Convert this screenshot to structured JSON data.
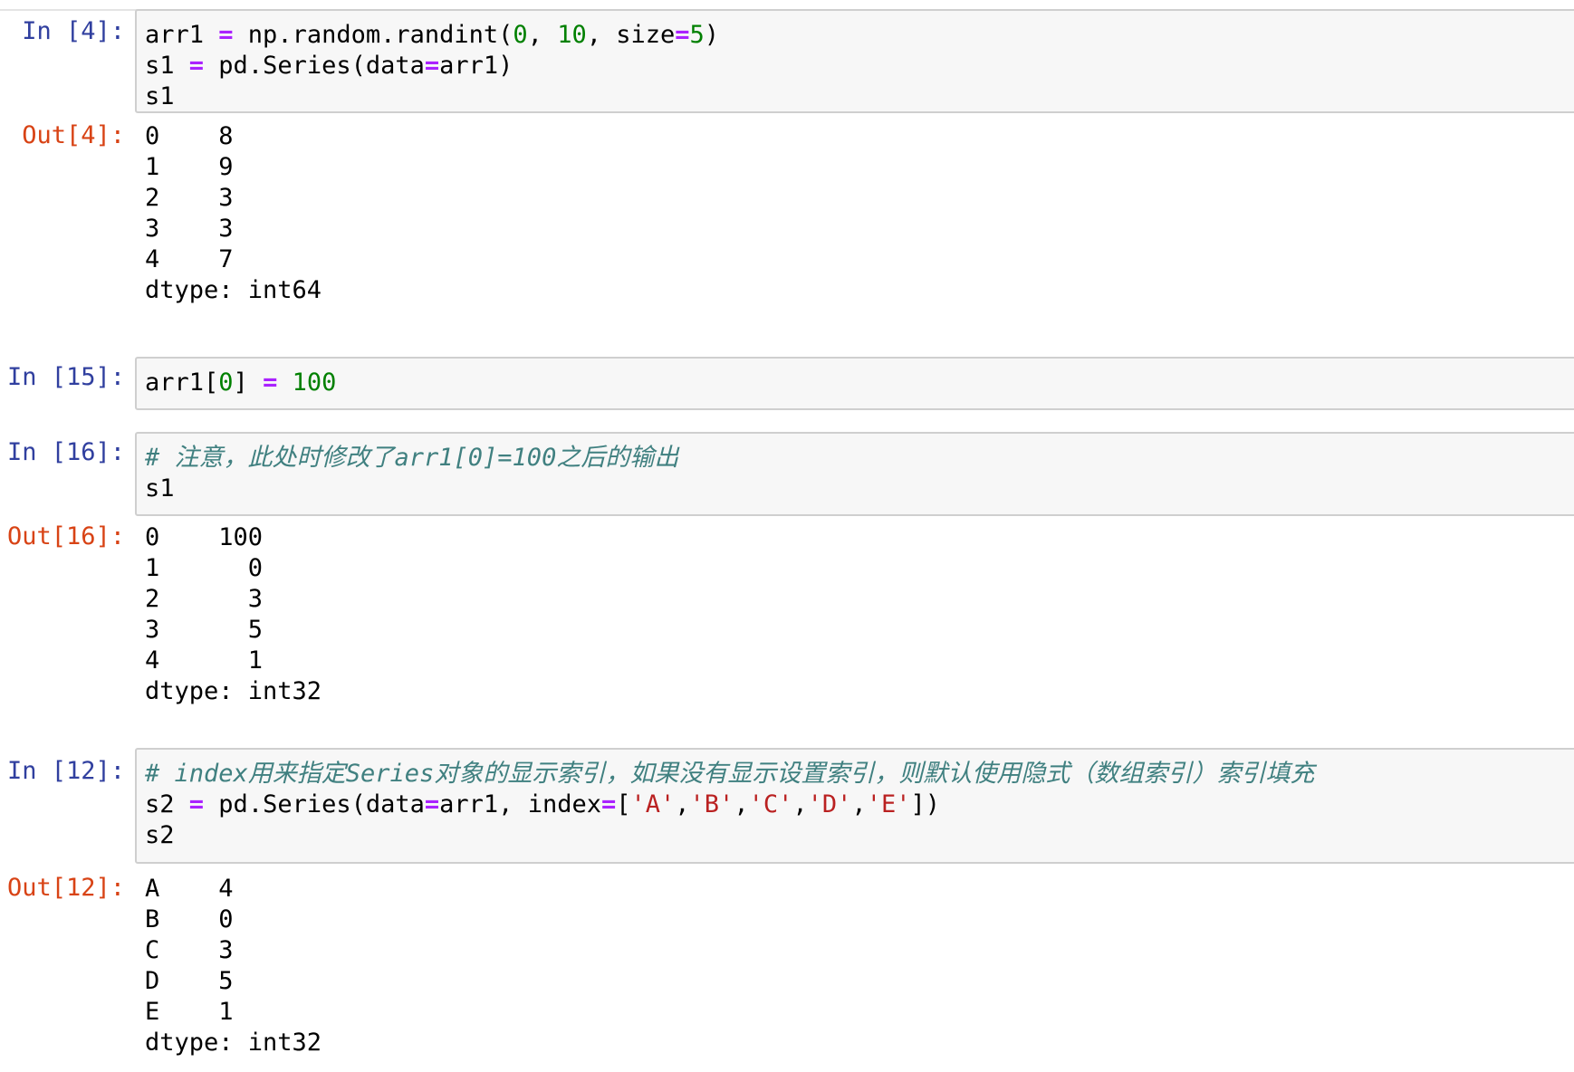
{
  "cells": [
    {
      "in_prompt": "In [4]:",
      "code": [
        [
          [
            "arr1 ",
            ""
          ],
          [
            "=",
            "op"
          ],
          [
            " np.random.randint(",
            ""
          ],
          [
            "0",
            "num"
          ],
          [
            ", ",
            ""
          ],
          [
            "10",
            "num"
          ],
          [
            ", size",
            ""
          ],
          [
            "=",
            "op"
          ],
          [
            "5",
            "num"
          ],
          [
            ")",
            ""
          ]
        ],
        [
          [
            "s1 ",
            ""
          ],
          [
            "=",
            "op"
          ],
          [
            " pd.Series(data",
            ""
          ],
          [
            "=",
            "op"
          ],
          [
            "arr1)",
            ""
          ]
        ],
        [
          [
            "s1",
            ""
          ]
        ]
      ],
      "out_prompt": "Out[4]:",
      "output": [
        "0    8",
        "1    9",
        "2    3",
        "3    3",
        "4    7",
        "dtype: int64"
      ]
    },
    {
      "in_prompt": "In [15]:",
      "code": [
        [
          [
            "arr1[",
            ""
          ],
          [
            "0",
            "num"
          ],
          [
            "] ",
            ""
          ],
          [
            "=",
            "op"
          ],
          [
            " ",
            ""
          ],
          [
            "100",
            "num"
          ]
        ]
      ]
    },
    {
      "in_prompt": "In [16]:",
      "code": [
        [
          [
            "# 注意，此处时修改了arr1[0]=100之后的输出",
            "comment"
          ]
        ],
        [
          [
            "s1",
            ""
          ]
        ]
      ],
      "out_prompt": "Out[16]:",
      "output": [
        "0    100",
        "1      0",
        "2      3",
        "3      5",
        "4      1",
        "dtype: int32"
      ]
    },
    {
      "in_prompt": "In [12]:",
      "code": [
        [
          [
            "# index用来指定Series对象的显示索引，如果没有显示设置索引，则默认使用隐式（数组索引）索引填充",
            "comment"
          ]
        ],
        [
          [
            "s2 ",
            ""
          ],
          [
            "=",
            "op"
          ],
          [
            " pd.Series(data",
            ""
          ],
          [
            "=",
            "op"
          ],
          [
            "arr1, index",
            ""
          ],
          [
            "=",
            "op"
          ],
          [
            "[",
            ""
          ],
          [
            "'A'",
            "str"
          ],
          [
            ",",
            ""
          ],
          [
            "'B'",
            "str"
          ],
          [
            ",",
            ""
          ],
          [
            "'C'",
            "str"
          ],
          [
            ",",
            ""
          ],
          [
            "'D'",
            "str"
          ],
          [
            ",",
            ""
          ],
          [
            "'E'",
            "str"
          ],
          [
            "])",
            ""
          ]
        ],
        [
          [
            "s2",
            ""
          ]
        ]
      ],
      "out_prompt": "Out[12]:",
      "output": [
        "A    4",
        "B    0",
        "C    3",
        "D    5",
        "E    1",
        "dtype: int32"
      ]
    }
  ]
}
